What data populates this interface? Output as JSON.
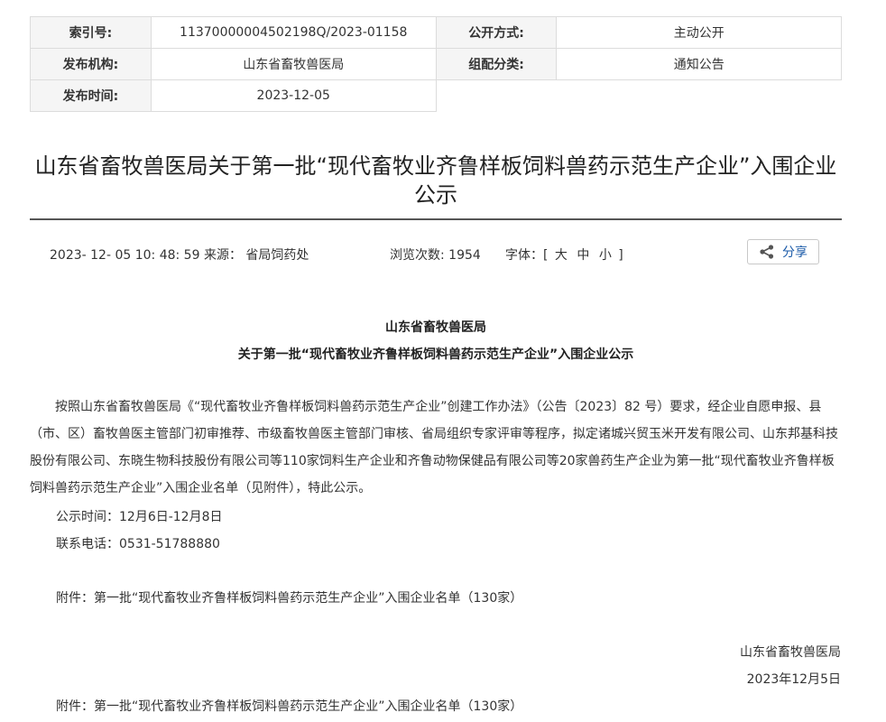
{
  "meta": {
    "index_label": "索引号:",
    "index_value": "11370000004502198Q/2023-01158",
    "open_method_label": "公开方式:",
    "open_method_value": "主动公开",
    "publisher_label": "发布机构:",
    "publisher_value": "山东省畜牧兽医局",
    "category_label": "组配分类:",
    "category_value": "通知公告",
    "date_label": "发布时间:",
    "date_value": "2023-12-05"
  },
  "title": "山东省畜牧兽医局关于第一批“现代畜牧业齐鲁样板饲料兽药示范生产企业”入围企业公示",
  "info": {
    "datetime_source": "2023- 12- 05 10: 48: 59 来源： 省局饲药处",
    "views": "浏览次数: 1954",
    "font_label": "字体：[",
    "font_large": "大",
    "font_medium": "中",
    "font_small": "小",
    "font_close": "]",
    "share_label": "分享"
  },
  "article": {
    "org": "山东省畜牧兽医局",
    "subtitle": "关于第一批“现代畜牧业齐鲁样板饲料兽药示范生产企业”入围企业公示",
    "body": "按照山东省畜牧兽医局《“现代畜牧业齐鲁样板饲料兽药示范生产企业”创建工作办法》（公告〔2023〕82 号）要求，经企业自愿申报、县（市、区）畜牧兽医主管部门初审推荐、市级畜牧兽医主管部门审核、省局组织专家评审等程序，拟定诸城兴贸玉米开发有限公司、山东邦基科技股份有限公司、东晓生物科技股份有限公司等110家饲料生产企业和齐鲁动物保健品有限公司等20家兽药生产企业为第一批“现代畜牧业齐鲁样板饲料兽药示范生产企业”入围企业名单（见附件），特此公示。",
    "period": "公示时间：12月6日-12月8日",
    "phone": "联系电话：0531-51788880",
    "attachment_note": "附件：第一批“现代畜牧业齐鲁样板饲料兽药示范生产企业”入围企业名单（130家）",
    "sign_org": "山东省畜牧兽医局",
    "sign_date": "2023年12月5日",
    "attachment_link": "附件：第一批“现代畜牧业齐鲁样板饲料兽药示范生产企业”入围企业名单（130家）"
  },
  "icons": {
    "share": "share-icon"
  },
  "colors": {
    "link": "#1a5aa8",
    "rule": "#555555",
    "label_bg": "#f5f5f5"
  }
}
